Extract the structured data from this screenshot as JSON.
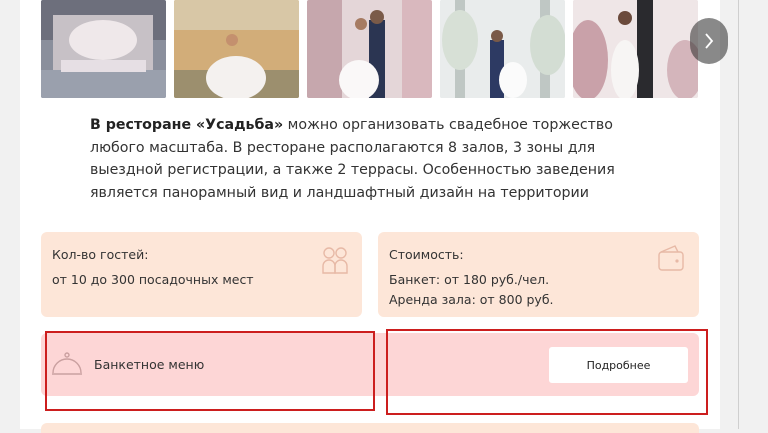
{
  "gallery": {
    "photos": [
      "wedding-hall-photo",
      "wedding-couple-photo",
      "wedding-couple-photo",
      "wedding-couple-photo",
      "wedding-couple-photo"
    ],
    "next_icon": "chevron-right-icon"
  },
  "description": {
    "restaurant": "В ресторане «Усадьба»",
    "text": " можно организовать свадебное торжество любого масштаба. В ресторане располагаются 8 залов, 3 зоны для выездной регистрации, а также 2 террасы. Особенностью заведения является панорамный вид и ландшафтный дизайн на территории"
  },
  "guests": {
    "title": "Кол-во гостей:",
    "value": "от 10 до 300 посадочных мест",
    "icon": "guests-icon"
  },
  "cost": {
    "title": "Стоимость:",
    "banquet": "Банкет: от 180 руб./чел.",
    "rent": "Аренда зала: от 800 руб.",
    "icon": "wallet-icon"
  },
  "menu": {
    "label": "Банкетное меню",
    "icon": "cloche-icon",
    "button": "Подробнее"
  },
  "colors": {
    "info_bg": "#fde6d8",
    "menu_bg": "#fdd6d6",
    "highlight": "#cc1e1e"
  }
}
